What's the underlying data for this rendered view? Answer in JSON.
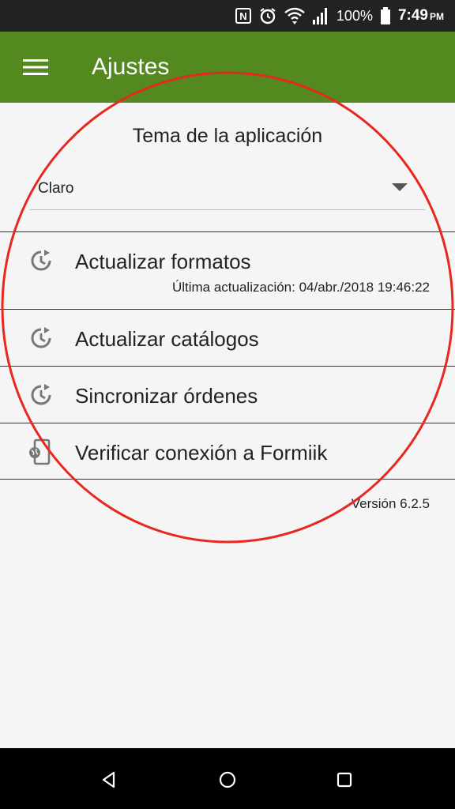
{
  "status_bar": {
    "nfc_letter": "N",
    "battery_text": "100%",
    "time": "7:49",
    "ampm": "PM"
  },
  "app_bar": {
    "title": "Ajustes",
    "background": "#54891f"
  },
  "theme": {
    "title": "Tema de la aplicación",
    "selected": "Claro"
  },
  "items": [
    {
      "label": "Actualizar formatos",
      "sublabel": "Última actualización: 04/abr./2018 19:46:22",
      "icon": "history-icon"
    },
    {
      "label": "Actualizar catálogos",
      "icon": "history-icon"
    },
    {
      "label": "Sincronizar órdenes",
      "icon": "history-icon"
    },
    {
      "label": "Verificar conexión a Formiik",
      "icon": "phone-globe-icon"
    }
  ],
  "version": "Versión 6.2.5",
  "annotation_color": "#e8281e"
}
